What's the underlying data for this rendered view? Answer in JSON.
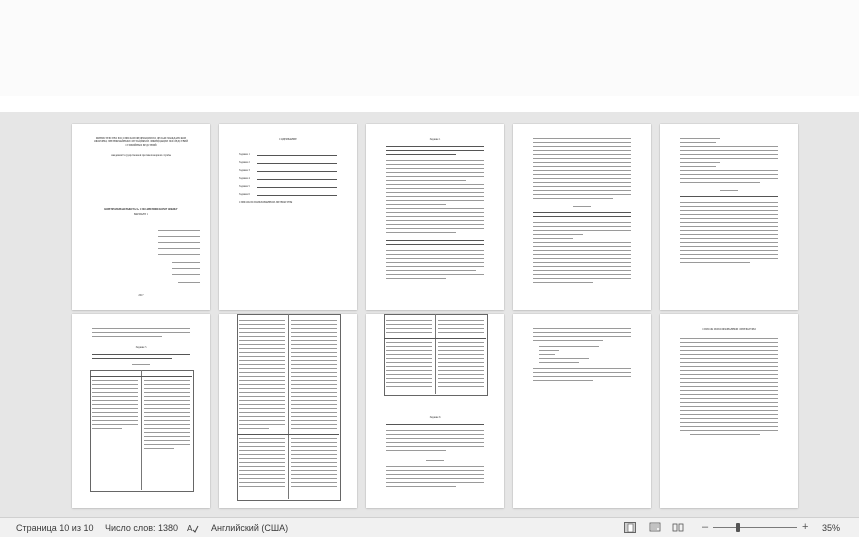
{
  "statusbar": {
    "page_info": "Страница 10 из 10",
    "word_count": "Число слов: 1380",
    "language": "Английский (США)",
    "zoom_level": "35%",
    "zoom_minus": "–",
    "zoom_plus": "+"
  },
  "pages": {
    "title": {
      "ministry": "МИНИСТЕРСТВО РОССИЙСКОЙ ФЕДЕРАЦИИ ПО ДЕЛАМ ГРАЖДАНСКОЙ ОБОРОНЫ, ЧРЕЗВЫЧАЙНЫМ СИТУАЦИЯМ И ЛИКВИДАЦИИ ПОСЛЕДСТВИЙ СТИХИЙНЫХ БЕДСТВИЙ",
      "academy": "Академия Государственной противопожарной службы",
      "work_title": "КОНТРОЛЬНАЯ РАБОТА № 1 ПО АНГЛИЙСКОМУ ЯЗЫКУ",
      "variant": "ВАРИАНТ 1",
      "year": "2017"
    },
    "contents": {
      "heading": "СОДЕРЖАНИЕ",
      "items": [
        "Задание 1",
        "Задание 2",
        "Задание 3",
        "Задание 4",
        "Задание 5",
        "Задание 6",
        "Задание 7"
      ],
      "references": "СПИСОК ИСПОЛЬЗОВАННОЙ ЛИТЕРАТУРЫ"
    },
    "task1": {
      "heading": "Задание 1"
    },
    "bibliography": {
      "heading": "СПИСОК ИСПОЛЬЗОВАННОЙ ЛИТЕРАТУРЫ"
    },
    "task5": {
      "heading": "Задание 5"
    },
    "task6": {
      "heading": "Задание 6"
    }
  },
  "colors": {
    "canvas": "#e6e6e6",
    "statusbar": "#f1f1f1",
    "page": "#ffffff"
  }
}
